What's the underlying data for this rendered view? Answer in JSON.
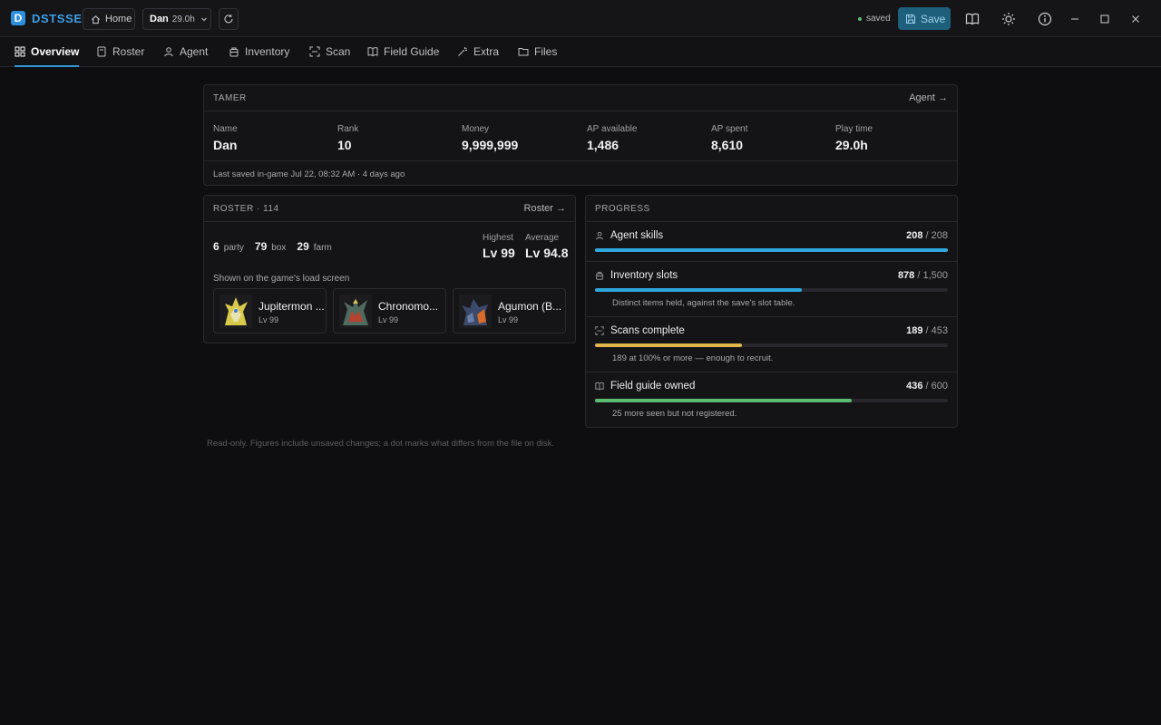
{
  "app": {
    "logo_letter": "D",
    "name": "DSTSSE",
    "home_label": "Home",
    "profile_name": "Dan",
    "profile_time": "29.0h",
    "status": "saved",
    "save_label": "Save",
    "accent": "#2d9ad6"
  },
  "tabs": [
    {
      "label": "Overview",
      "icon": "grid-icon",
      "active": true
    },
    {
      "label": "Roster",
      "icon": "cards-icon"
    },
    {
      "label": "Agent",
      "icon": "person-icon"
    },
    {
      "label": "Inventory",
      "icon": "bag-icon"
    },
    {
      "label": "Scan",
      "icon": "scan-icon"
    },
    {
      "label": "Field Guide",
      "icon": "book-icon"
    },
    {
      "label": "Extra",
      "icon": "wand-icon"
    },
    {
      "label": "Files",
      "icon": "folder-icon"
    }
  ],
  "tamer": {
    "title": "TAMER",
    "link": "Agent →",
    "stats": [
      {
        "label": "Name",
        "value": "Dan"
      },
      {
        "label": "Rank",
        "value": "10"
      },
      {
        "label": "Money",
        "value": "9,999,999"
      },
      {
        "label": "AP available",
        "value": "1,486"
      },
      {
        "label": "AP spent",
        "value": "8,610"
      },
      {
        "label": "Play time",
        "value": "29.0h"
      }
    ],
    "last_saved": "Last saved in-game Jul 22, 08:32 AM · 4 days ago"
  },
  "roster": {
    "title": "ROSTER · 114",
    "link": "Roster →",
    "party_count": "6",
    "party_label": "party",
    "box_count": "79",
    "box_label": "box",
    "farm_count": "29",
    "farm_label": "farm",
    "highest_label": "Highest",
    "highest_value": "Lv 99",
    "average_label": "Average",
    "average_value": "Lv 94.8",
    "load_screen_label": "Shown on the game's load screen",
    "featured": [
      {
        "name": "Jupitermon ...",
        "level": "Lv 99"
      },
      {
        "name": "Chronomo...",
        "level": "Lv 99"
      },
      {
        "name": "Agumon (B...",
        "level": "Lv 99"
      }
    ]
  },
  "progress": {
    "title": "PROGRESS",
    "items": [
      {
        "label": "Agent skills",
        "current": "208",
        "total": "/ 208",
        "fraction": 1.0,
        "color": "#2fa8e0",
        "icon": "person-icon",
        "note": ""
      },
      {
        "label": "Inventory slots",
        "current": "878",
        "total": "/ 1,500",
        "fraction": 0.585,
        "color": "#2fa8e0",
        "icon": "bag-icon",
        "note": "Distinct items held, against the save's slot table."
      },
      {
        "label": "Scans complete",
        "current": "189",
        "total": "/ 453",
        "fraction": 0.417,
        "color": "#e0b54a",
        "icon": "scan-icon",
        "note": "189 at 100% or more — enough to recruit."
      },
      {
        "label": "Field guide owned",
        "current": "436",
        "total": "/ 600",
        "fraction": 0.727,
        "color": "#5bbd72",
        "icon": "book-icon",
        "note": "25 more seen but not registered."
      }
    ]
  },
  "footnote": "Read-only. Figures include unsaved changes; a dot marks what differs from the file on disk."
}
